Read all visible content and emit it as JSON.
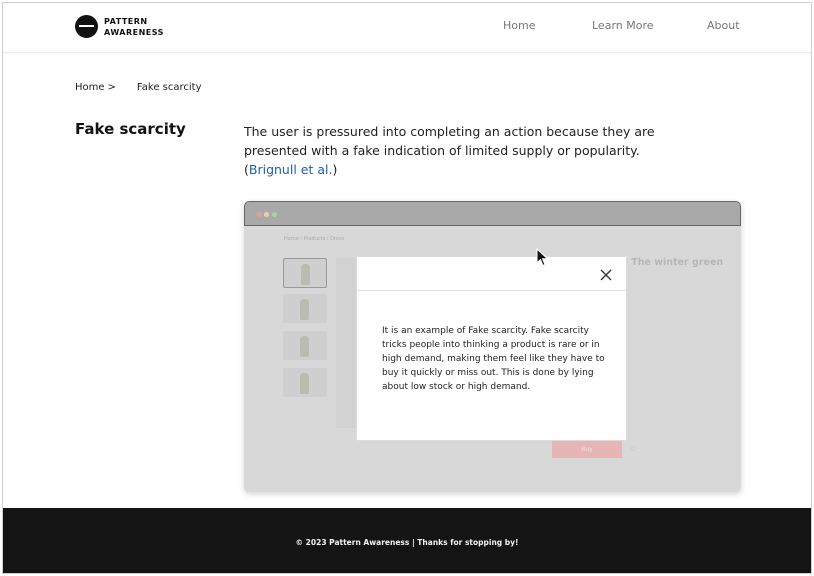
{
  "brand": {
    "line1": "PATTERN",
    "line2": "AWARENESS"
  },
  "nav": {
    "home": "Home",
    "learn_more": "Learn More",
    "about": "About"
  },
  "breadcrumb": {
    "home": "Home",
    "separator": ">",
    "current": "Fake scarcity"
  },
  "pattern": {
    "title": "Fake scarcity",
    "description": "The user is pressured into completing an action because they are presented with a fake indication of limited supply or popularity.",
    "citation_open": "(",
    "citation_link": "Brignull et al.",
    "citation_close": ")"
  },
  "mock_page": {
    "breadcrumb": "Home / Products / Dress",
    "product_title": "- The winter green",
    "buy_label": "Buy",
    "heart_glyph": "♡"
  },
  "modal": {
    "body": "It is an example of Fake scarcity. Fake scarcity tricks people into thinking a product is rare or in high demand, making them feel like they have to buy it quickly or miss out. This is done by lying about low stock or high demand."
  },
  "footer": {
    "text": "© 2023 Pattern Awareness | Thanks for stopping by!"
  }
}
